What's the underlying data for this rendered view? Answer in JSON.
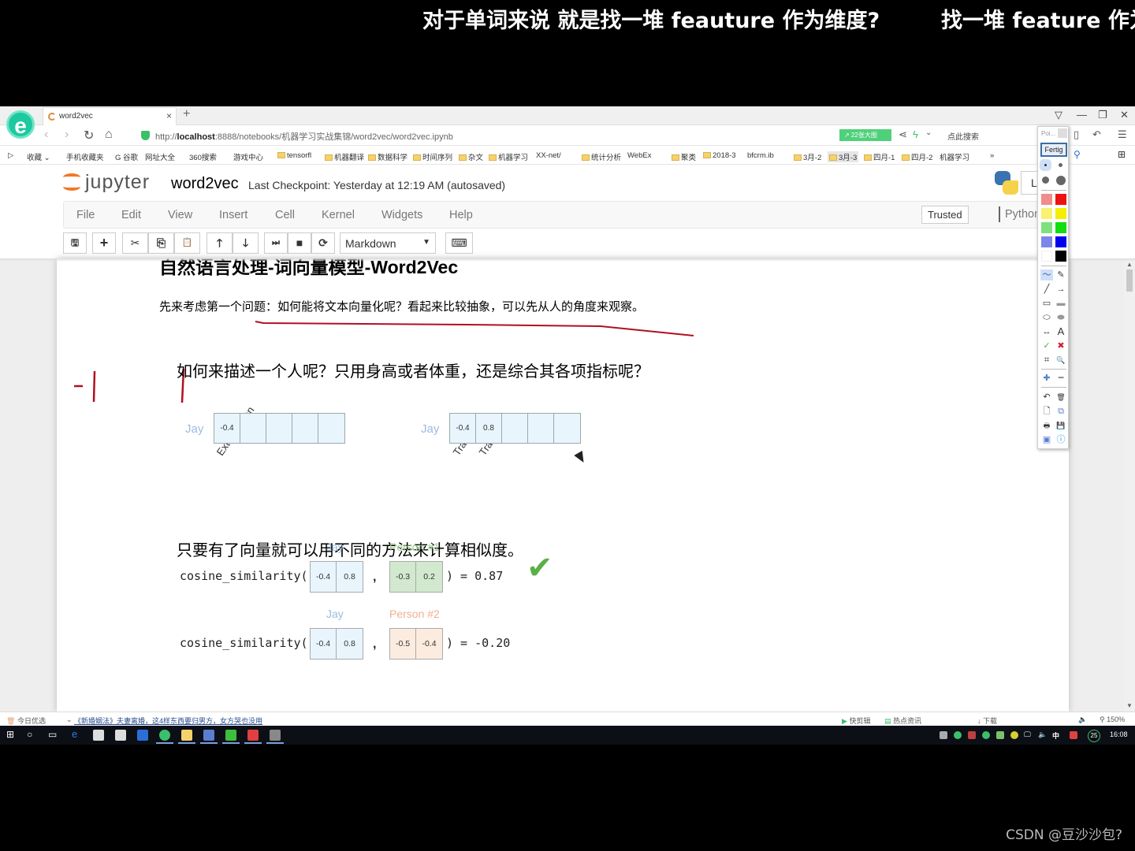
{
  "subtitles": {
    "line1": "对于单词来说 就是找一堆 feauture 作为维度?",
    "line2": "找一堆 feature 作为"
  },
  "watermark": "CSDN @豆沙沙包?",
  "browser": {
    "logo_letter": "e",
    "tab_title": "word2vec",
    "tab_close": "×",
    "new_tab": "+",
    "window_controls": [
      "▽",
      "—",
      "❐",
      "✕"
    ],
    "url_prefix": "http://",
    "url_host": "localhost",
    "url_rest": ":8888/notebooks/机器学习实战集锦/word2vec/word2vec.ipynb",
    "badge": "↗ 22张大图",
    "search_hint": "点此搜索",
    "bookmarks": [
      "收藏 ⌄",
      "手机收藏夹",
      "G 谷歌",
      "网址大全",
      "360搜索",
      "游戏中心",
      "tensorfl",
      "机器翻译",
      "数据科学",
      "时间序列",
      "杂文",
      "机器学习",
      "XX-net/",
      "统计分析",
      "WebEx",
      "聚类",
      "2018-3",
      "bfcrm.ib",
      "3月-2",
      "3月-3",
      "四月-1",
      "四月-2",
      "机器学习",
      "»"
    ]
  },
  "jupyter": {
    "brand": "jupyter",
    "notebook_name": "word2vec",
    "checkpoint": "Last Checkpoint: Yesterday at 12:19 AM (autosaved)",
    "logout_label": "L",
    "menu": [
      "File",
      "Edit",
      "View",
      "Insert",
      "Cell",
      "Kernel",
      "Widgets",
      "Help"
    ],
    "trusted": "Trusted",
    "kernel": "Python",
    "toolbar": {
      "save_icon": "🖫",
      "add_icon": "+",
      "cut_icon": "✂",
      "copy_icon": "⎘",
      "paste_icon": "📋",
      "up_icon": "🡑",
      "down_icon": "🡓",
      "run_icon": "⏭",
      "stop_icon": "■",
      "restart_icon": "⟳",
      "cell_type": "Markdown",
      "keyboard_icon": "⌨"
    }
  },
  "content": {
    "heading": "自然语言处理-词向量模型-Word2Vec",
    "intro": "先来考虑第一个问题：如何能将文本向量化呢？看起来比较抽象，可以先从人的角度来观察。",
    "question": "如何来描述一个人呢？只用身高或者体重，还是综合其各项指标呢？",
    "figure1": {
      "row_label": "Jay",
      "column_label": "Extraversion",
      "values": [
        "-0.4",
        "",
        "",
        "",
        ""
      ]
    },
    "figure2": {
      "row_label": "Jay",
      "column_labels": [
        "Trait #1",
        "Trait #2"
      ],
      "values": [
        "-0.4",
        "0.8",
        "",
        "",
        ""
      ]
    },
    "similarity_intro": "只要有了向量就可以用不同的方法来计算相似度。",
    "comparisons": [
      {
        "fn": "cosine_similarity(",
        "a_label": "Jay",
        "a": [
          "-0.4",
          "0.8"
        ],
        "b_label": "Person #1",
        "b": [
          "-0.3",
          "0.2"
        ],
        "comma": ",",
        "result": ") = 0.87",
        "check": "✔",
        "b_color": "#d2e8cf",
        "b_label_color": "#9ccf8c"
      },
      {
        "fn": "cosine_similarity(",
        "a_label": "Jay",
        "a": [
          "-0.4",
          "0.8"
        ],
        "b_label": "Person #2",
        "b": [
          "-0.5",
          "-0.4"
        ],
        "comma": ",",
        "result": ") = -0.20",
        "b_color": "#fcece0",
        "b_label_color": "#f0b090"
      }
    ]
  },
  "annotation_tool": {
    "pointer_label": "Poi...",
    "done_label": "Fertig",
    "colors": [
      "#f28b8b",
      "#ee1111",
      "#f9f171",
      "#f5ee00",
      "#7ee07e",
      "#11dd11",
      "#7d86e8",
      "#0000ee",
      "#ffffff",
      "#000000"
    ],
    "tools": [
      "〜",
      "✎",
      "╱",
      "→",
      "▭",
      "▬",
      "⬭",
      "⬬",
      "↔",
      "A",
      "✓",
      "✖",
      "⌗",
      "🔍",
      "✚",
      "━",
      "↶",
      "🗑",
      "🗋",
      "⧉",
      "🖶",
      "💾",
      "▣",
      "ⓘ"
    ]
  },
  "statusbar": {
    "left_label": "今日优选",
    "news": "《新婚姻法》夫妻离婚，这4样东西要归男方，女方哭也没用",
    "right_items": [
      "快剪辑",
      "热点资讯",
      "下载",
      "150%"
    ]
  },
  "taskbar": {
    "ime": "中",
    "badge": "25",
    "clock": "16:08"
  }
}
